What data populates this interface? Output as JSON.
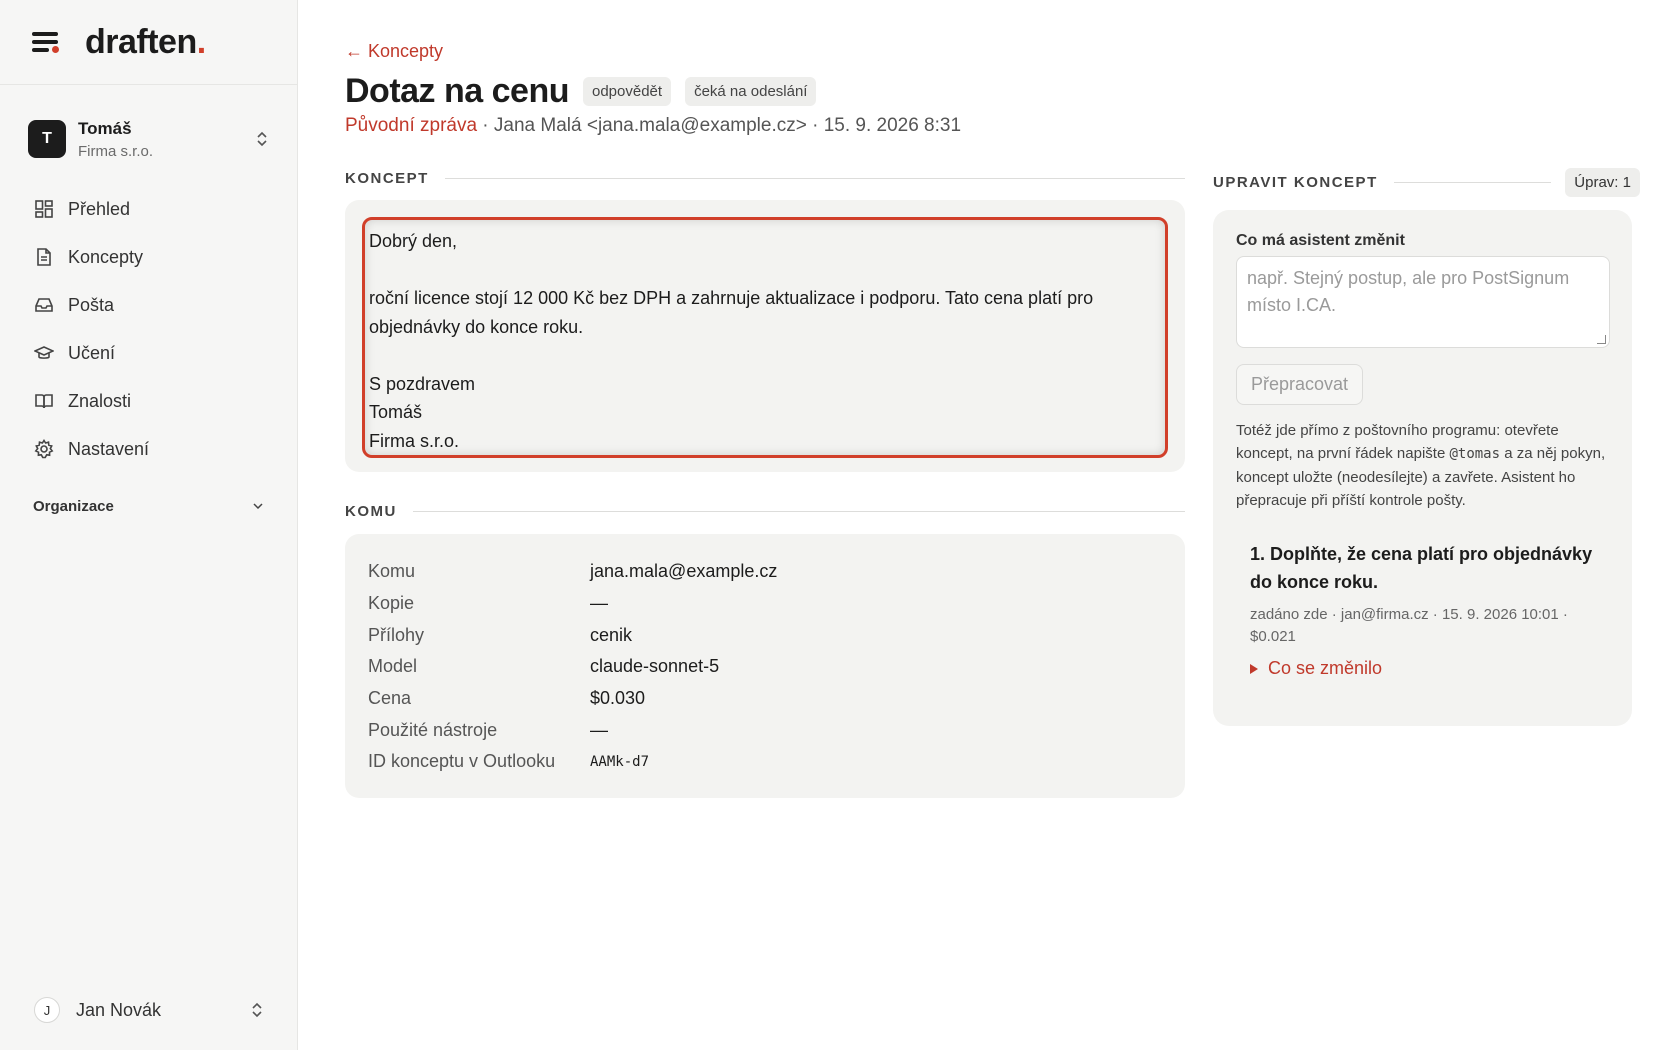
{
  "brand": {
    "name": "draften",
    "dot": "."
  },
  "account": {
    "initial": "T",
    "name": "Tomáš",
    "org": "Firma s.r.o."
  },
  "nav": {
    "items": [
      {
        "label": "Přehled",
        "icon": "grid-icon"
      },
      {
        "label": "Koncepty",
        "icon": "document-icon"
      },
      {
        "label": "Pošta",
        "icon": "inbox-icon"
      },
      {
        "label": "Učení",
        "icon": "graduation-cap-icon"
      },
      {
        "label": "Znalosti",
        "icon": "book-icon"
      },
      {
        "label": "Nastavení",
        "icon": "gear-icon"
      }
    ],
    "section": "Organizace"
  },
  "user": {
    "initial": "J",
    "name": "Jan Novák"
  },
  "header": {
    "back_label": "← Koncepty",
    "title": "Dotaz na cenu",
    "badges": [
      "odpovědět",
      "čeká na odeslání"
    ],
    "meta_link": "Původní zpráva",
    "meta_rest": " · Jana Malá <jana.mala@example.cz> · 15. 9. 2026 8:31"
  },
  "concept": {
    "label": "KONCEPT",
    "body": "Dobrý den,\n\nroční licence stojí 12 000 Kč bez DPH a zahrnuje aktualizace i podporu. Tato cena platí pro objednávky do konce roku.\n\nS pozdravem\nTomáš\nFirma s.r.o."
  },
  "komu": {
    "label": "KOMU",
    "rows": [
      {
        "key": "Komu",
        "value": "jana.mala@example.cz"
      },
      {
        "key": "Kopie",
        "value": "—"
      },
      {
        "key": "Přílohy",
        "value": "cenik"
      },
      {
        "key": "Model",
        "value": "claude-sonnet-5"
      },
      {
        "key": "Cena",
        "value": "$0.030"
      },
      {
        "key": "Použité nástroje",
        "value": "—"
      },
      {
        "key": "ID konceptu v Outlooku",
        "value": "AAMk-d7"
      }
    ]
  },
  "edit": {
    "label": "UPRAVIT KONCEPT",
    "count": "Úprav: 1",
    "field_label": "Co má asistent změnit",
    "placeholder": "např. Stejný postup, ale pro PostSignum místo I.CA.",
    "button": "Přepracovat",
    "help_before": "Totéž jde přímo z poštovního programu: otevřete koncept, na první řádek napište ",
    "help_code": "@tomas",
    "help_after": " a za něj pokyn, koncept uložte (neodesílejte) a zavřete. Asistent ho přepracuje při příští kontrole pošty.",
    "history": [
      {
        "instruction": "1. Doplňte, že cena platí pro objednávky do konce roku.",
        "meta": "zadáno zde · jan@firma.cz · 15. 9. 2026 10:01 · $0.021",
        "changes_label": "Co se změnilo"
      }
    ]
  },
  "colors": {
    "accent": "#d13f2a",
    "link": "#c0392b"
  }
}
